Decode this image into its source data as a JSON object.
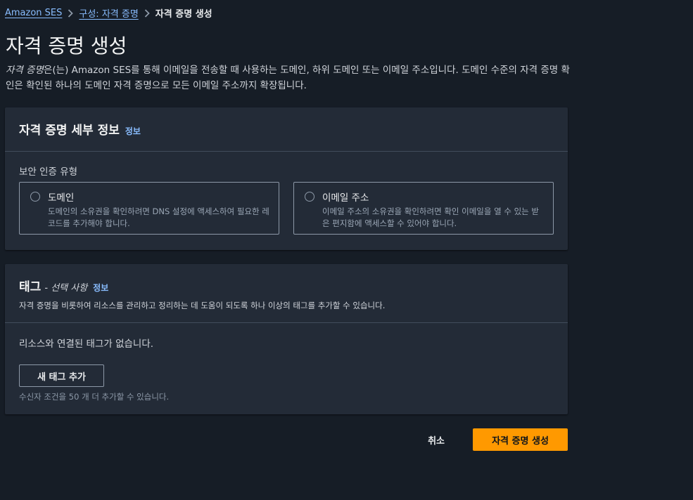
{
  "breadcrumb": {
    "items": [
      {
        "label": "Amazon SES"
      },
      {
        "label": "구성: 자격 증명"
      },
      {
        "label": "자격 증명 생성"
      }
    ]
  },
  "page": {
    "title": "자격 증명 생성",
    "description_em": "자격 증명",
    "description_rest": "은(는) Amazon SES를 통해 이메일을 전송할 때 사용하는 도메인, 하위 도메인 또는 이메일 주소입니다. 도메인 수준의 자격 증명 확인은 확인된 하나의 도메인 자격 증명으로 모든 이메일 주소까지 확장됩니다."
  },
  "details_card": {
    "title": "자격 증명 세부 정보",
    "info": "정보",
    "field_label": "보안 인증 유형",
    "options": [
      {
        "label": "도메인",
        "description": "도메인의 소유권을 확인하려면 DNS 설정에 액세스하여 필요한 레코드를 추가해야 합니다."
      },
      {
        "label": "이메일 주소",
        "description": "이메일 주소의 소유권을 확인하려면 확인 이메일을 열 수 있는 받은 편지함에 액세스할 수 있어야 합니다."
      }
    ]
  },
  "tags_card": {
    "title": "태그",
    "optional": "- 선택 사항",
    "info": "정보",
    "description": "자격 증명을 비롯하여 리소스를 관리하고 정리하는 데 도움이 되도록 하나 이상의 태그를 추가할 수 있습니다.",
    "empty_text": "리소스와 연결된 태그가 없습니다.",
    "add_button": "새 태그 추가",
    "hint": "수신자 조건을 50 개 더 추가할 수 있습니다."
  },
  "actions": {
    "cancel": "취소",
    "submit": "자격 증명 생성"
  },
  "colors": {
    "background": "#161d26",
    "card": "#232b37",
    "link": "#89bdff",
    "primary": "#ff9900"
  }
}
